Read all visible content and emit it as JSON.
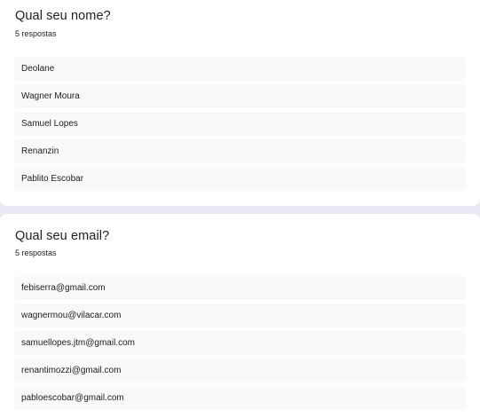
{
  "questions": [
    {
      "title": "Qual seu nome?",
      "count": "5 respostas",
      "answers": [
        "Deolane",
        "Wagner Moura",
        "Samuel Lopes",
        "Renanzin",
        "Pablito Escobar"
      ]
    },
    {
      "title": "Qual seu email?",
      "count": "5 respostas",
      "answers": [
        "febiserra@gmail.com",
        "wagnermou@vilacar.com",
        "samuellopes.jtm@gmail.com",
        "renantimozzi@gmail.com",
        "pabloescobar@gmail.com"
      ]
    }
  ]
}
